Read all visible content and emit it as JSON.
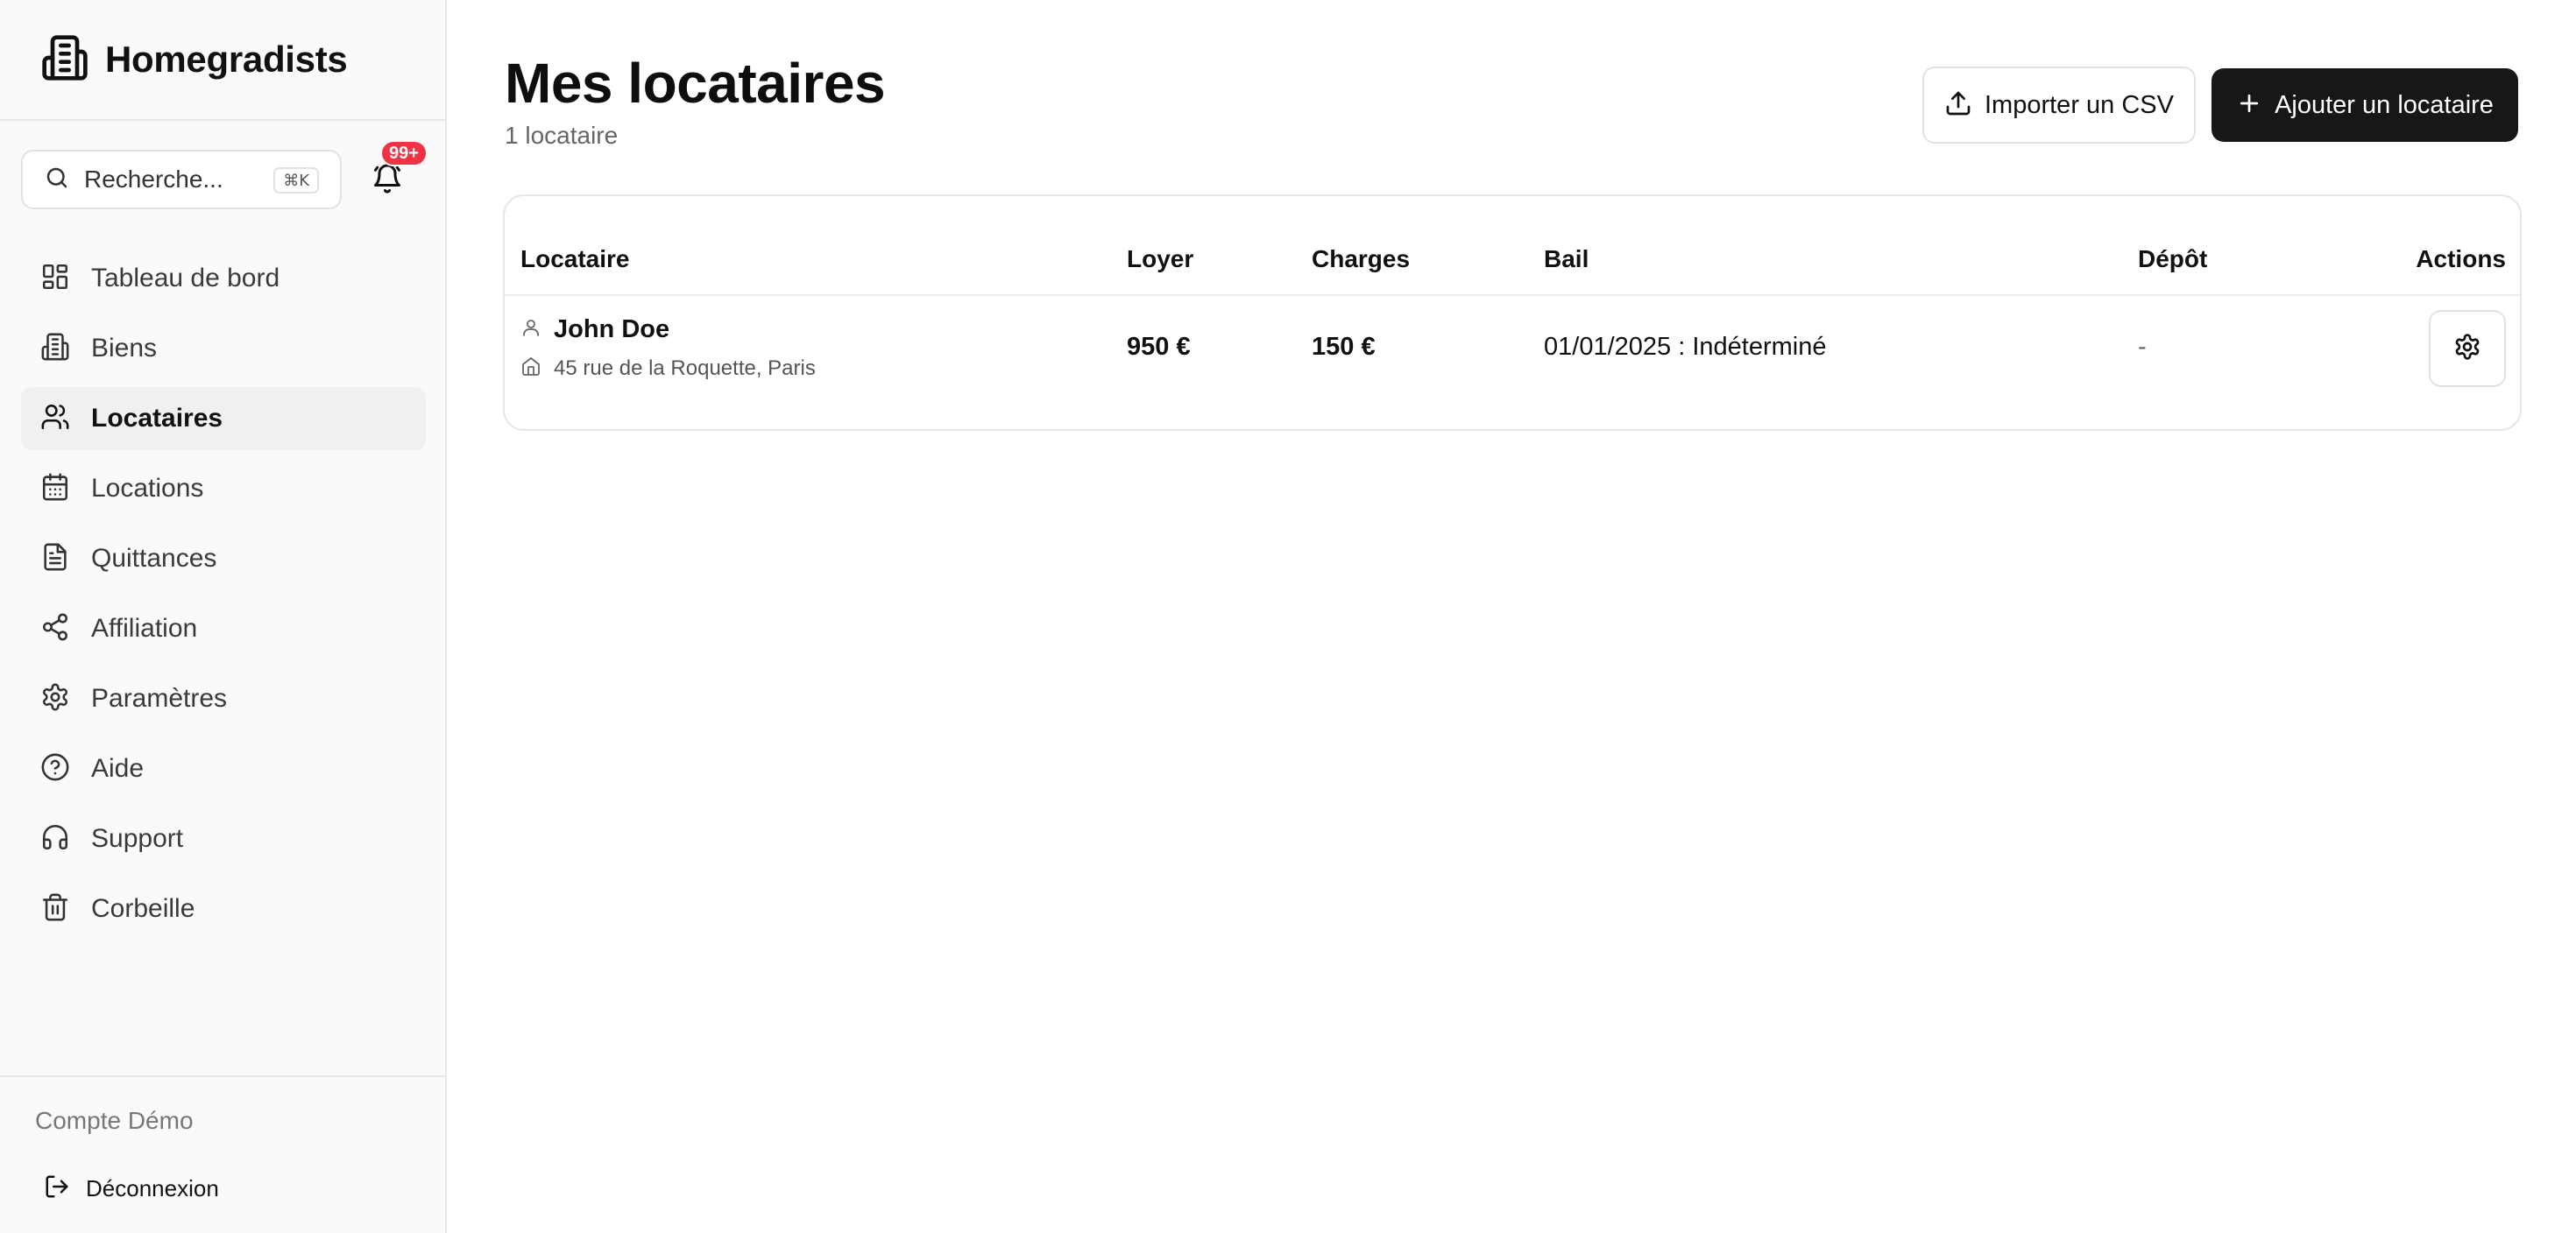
{
  "brand": {
    "name": "Homegradists",
    "icon": "building-icon"
  },
  "search": {
    "placeholder": "Recherche...",
    "shortcut": "⌘K"
  },
  "notifications": {
    "count": "99+",
    "icon": "bell-icon"
  },
  "sidebar": {
    "items": [
      {
        "label": "Tableau de bord",
        "icon": "dashboard-icon",
        "active": false
      },
      {
        "label": "Biens",
        "icon": "building-icon",
        "active": false
      },
      {
        "label": "Locataires",
        "icon": "users-icon",
        "active": true
      },
      {
        "label": "Locations",
        "icon": "calendar-icon",
        "active": false
      },
      {
        "label": "Quittances",
        "icon": "document-icon",
        "active": false
      },
      {
        "label": "Affiliation",
        "icon": "share-icon",
        "active": false
      },
      {
        "label": "Paramètres",
        "icon": "gear-icon",
        "active": false
      },
      {
        "label": "Aide",
        "icon": "help-circle-icon",
        "active": false
      },
      {
        "label": "Support",
        "icon": "headphones-icon",
        "active": false
      },
      {
        "label": "Corbeille",
        "icon": "trash-icon",
        "active": false
      }
    ],
    "account": "Compte Démo",
    "logout": "Déconnexion"
  },
  "main": {
    "title": "Mes locataires",
    "subtitle": "1 locataire",
    "import_label": "Importer un CSV",
    "add_label": "Ajouter un locataire"
  },
  "table": {
    "headers": [
      "Locataire",
      "Loyer",
      "Charges",
      "Bail",
      "Dépôt",
      "Actions"
    ],
    "rows": [
      {
        "name": "John Doe",
        "address": "45 rue de la Roquette, Paris",
        "rent": "950 €",
        "charges": "150 €",
        "lease": "01/01/2025 : Indéterminé",
        "deposit": "-"
      }
    ]
  },
  "colors": {
    "accent": "#171717",
    "badge": "#ef3343",
    "sidebar_bg": "#fafafa"
  }
}
